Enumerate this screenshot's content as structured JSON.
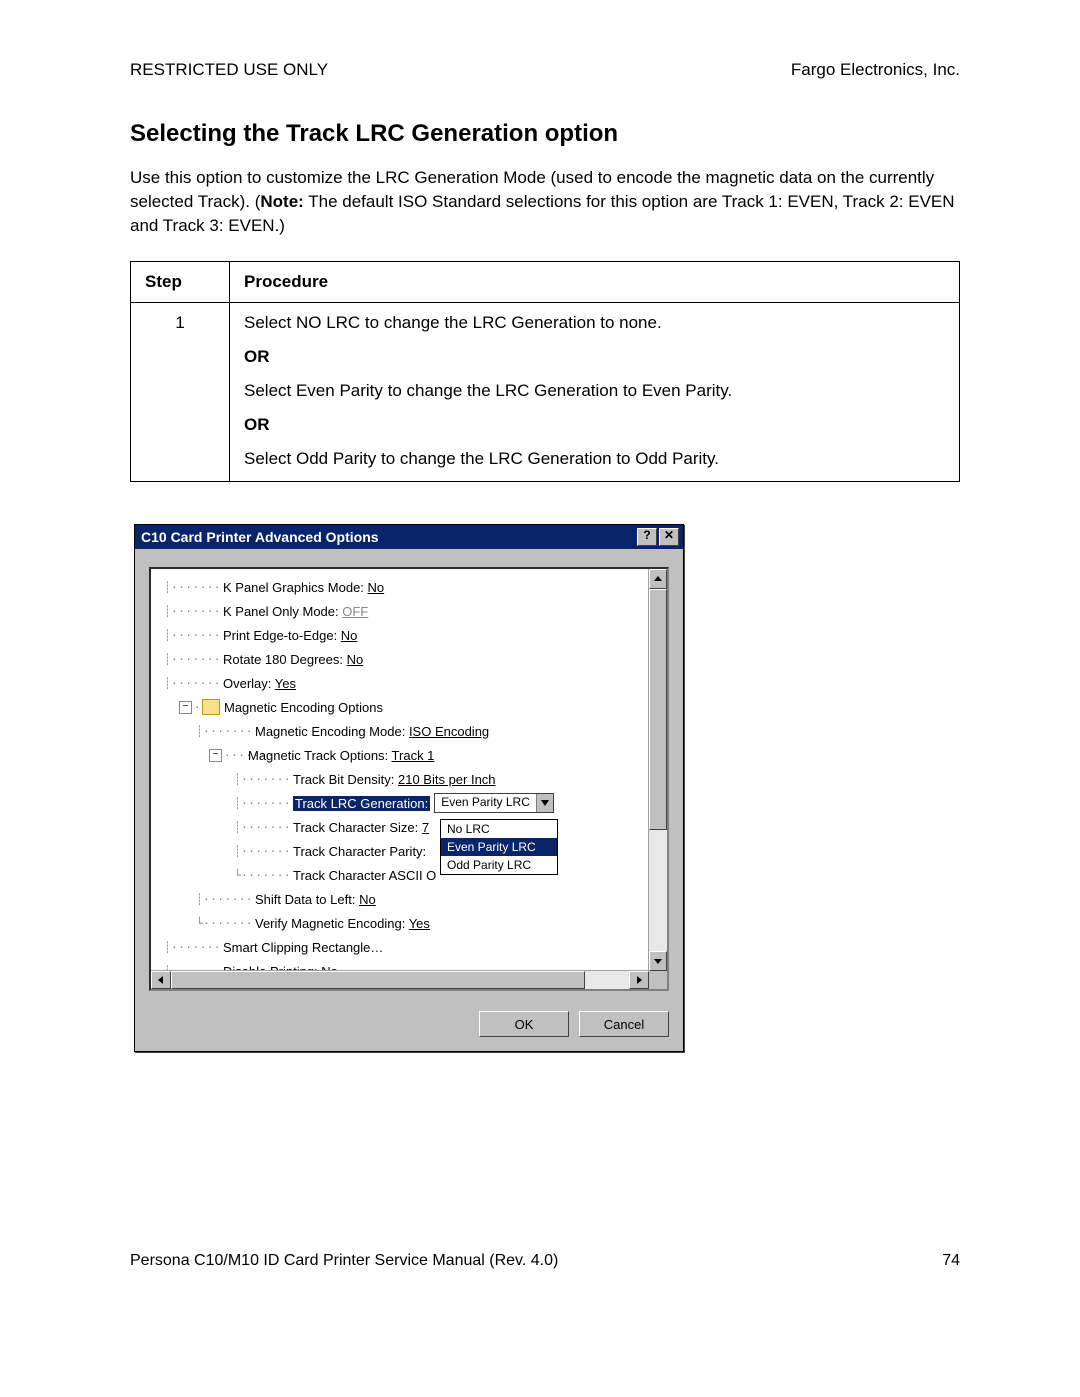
{
  "header": {
    "left": "RESTRICTED USE ONLY",
    "right": "Fargo Electronics, Inc."
  },
  "section_title": "Selecting the Track LRC Generation option",
  "intro_pre": "Use this option to customize the LRC Generation Mode (used to encode the magnetic data on the currently selected Track). (",
  "intro_note_label": "Note:",
  "intro_post": "  The default ISO Standard selections for this option are Track 1: EVEN, Track 2: EVEN and Track 3: EVEN.)",
  "table": {
    "h_step": "Step",
    "h_proc": "Procedure",
    "step_num": "1",
    "line1": "Select NO LRC to change the LRC Generation to none.",
    "or": "OR",
    "line2": "Select Even Parity to change the LRC Generation to Even Parity.",
    "line3": "Select Odd Parity to change the LRC Generation to Odd Parity."
  },
  "dialog": {
    "title": "C10 Card Printer Advanced Options",
    "help_btn": "?",
    "close_btn": "✕",
    "ok": "OK",
    "cancel": "Cancel",
    "tree": {
      "kpanel_graphics_label": "K Panel Graphics Mode: ",
      "kpanel_graphics_val": "No",
      "kpanel_only_label": "K Panel Only Mode: ",
      "kpanel_only_val": "OFF",
      "print_edge_label": "Print Edge-to-Edge: ",
      "print_edge_val": "No",
      "rotate_label": "Rotate 180 Degrees: ",
      "rotate_val": "No",
      "overlay_label": "Overlay: ",
      "overlay_val": "Yes",
      "mag_opts_label": "Magnetic Encoding Options",
      "mag_mode_label": "Magnetic Encoding Mode: ",
      "mag_mode_val": "ISO Encoding",
      "mag_track_label": "Magnetic Track Options: ",
      "mag_track_val": "Track 1",
      "bit_density_label": "Track Bit Density: ",
      "bit_density_val": "210 Bits per Inch",
      "lrc_gen_label": "Track LRC Generation:",
      "lrc_gen_value": "Even Parity LRC",
      "char_size_label": "Track Character Size: ",
      "char_size_val": "7",
      "char_parity_label": "Track Character Parity: ",
      "char_ascii_label": "Track Character ASCII O",
      "shift_label": "Shift Data to Left: ",
      "shift_val": "No",
      "verify_label": "Verify Magnetic Encoding: ",
      "verify_val": "Yes",
      "smart_clip_label": "Smart Clipping Rectangle…",
      "disable_print_label": "Disable Printing: ",
      "disable_print_val": "No"
    },
    "dropdown": {
      "opt_none": "No LRC",
      "opt_even": "Even Parity LRC",
      "opt_odd": "Odd Parity LRC"
    }
  },
  "footer": {
    "left": "Persona C10/M10 ID Card Printer Service Manual (Rev. 4.0)",
    "right": "74"
  }
}
